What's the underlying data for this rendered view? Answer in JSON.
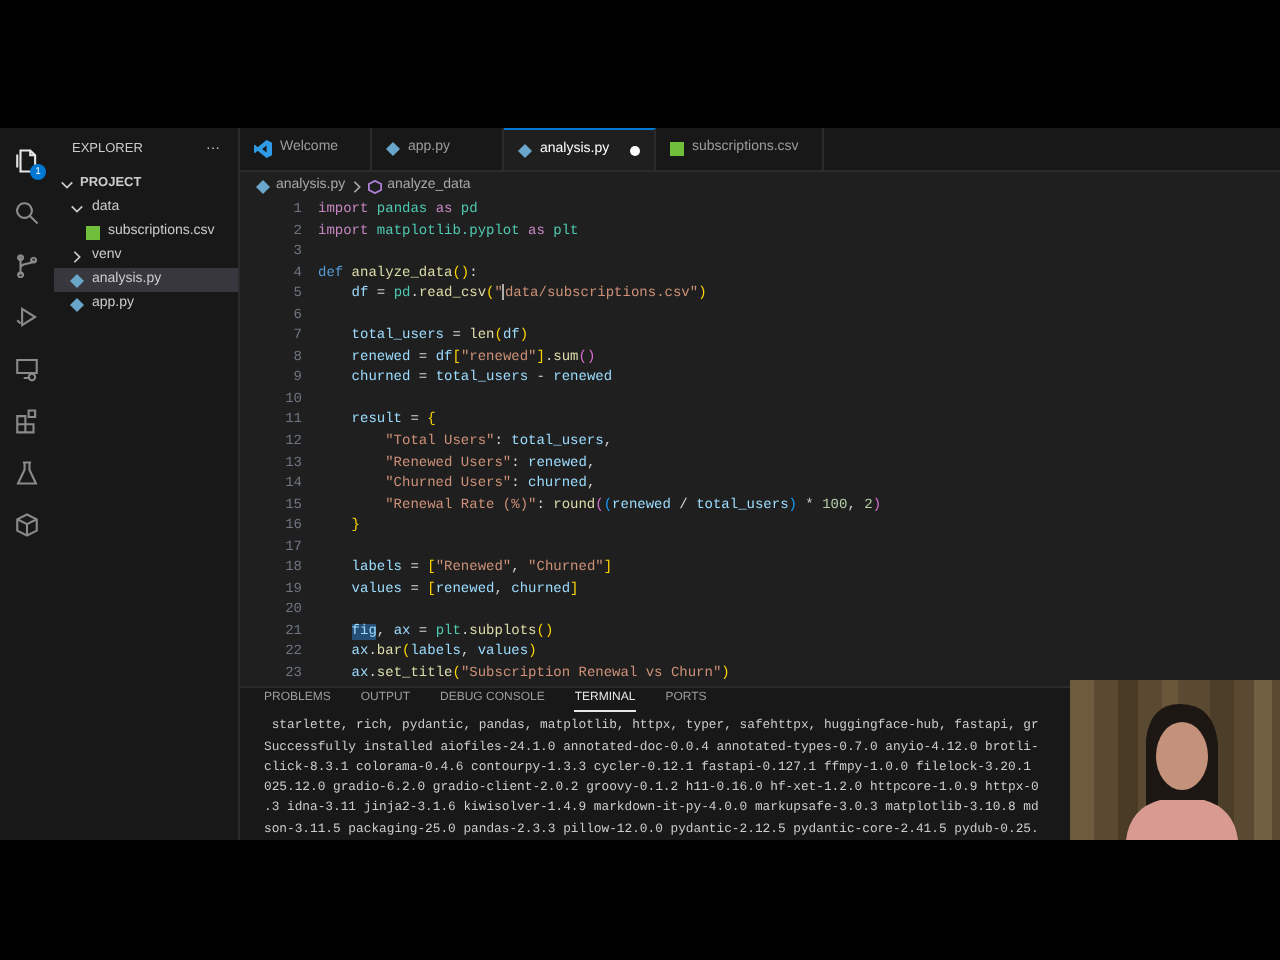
{
  "activity_bar": {
    "badge": "1"
  },
  "explorer": {
    "title": "EXPLORER",
    "more": "···",
    "project": {
      "label": "PROJECT",
      "expanded": true
    },
    "items": [
      {
        "label": "data",
        "kind": "folder",
        "expanded": true,
        "selected": false,
        "children": [
          {
            "label": "subscriptions.csv",
            "kind": "csv",
            "selected": false
          }
        ]
      },
      {
        "label": "venv",
        "kind": "folder",
        "expanded": false,
        "selected": false
      },
      {
        "label": "analysis.py",
        "kind": "py",
        "selected": true
      },
      {
        "label": "app.py",
        "kind": "py",
        "selected": false
      }
    ]
  },
  "tabs": [
    {
      "label": "Welcome",
      "kind": "vscode",
      "selected": false,
      "modified": false
    },
    {
      "label": "app.py",
      "kind": "py",
      "selected": false,
      "modified": false
    },
    {
      "label": "analysis.py",
      "kind": "py",
      "selected": true,
      "modified": true
    },
    {
      "label": "subscriptions.csv",
      "kind": "csv",
      "selected": false,
      "modified": false
    }
  ],
  "breadcrumb": {
    "file": "analysis.py",
    "symbol": "analyze_data"
  },
  "code": [
    {
      "number": "1",
      "tokens": [
        {
          "text": "import",
          "kind": "kw"
        },
        {
          "text": " pandas",
          "kind": "mod"
        },
        {
          "text": " as",
          "kind": "kw"
        },
        {
          "text": " pd",
          "kind": "mod"
        }
      ]
    },
    {
      "number": "2",
      "tokens": [
        {
          "text": "import",
          "kind": "kw"
        },
        {
          "text": " matplotlib.pyplot",
          "kind": "mod"
        },
        {
          "text": " as",
          "kind": "kw"
        },
        {
          "text": " plt",
          "kind": "mod"
        }
      ]
    },
    {
      "number": "3"
    },
    {
      "number": "4",
      "tokens": [
        {
          "text": "def",
          "kind": "def"
        },
        {
          "text": " analyze_data",
          "kind": "fn"
        },
        {
          "text": "()",
          "kind": "br1"
        },
        {
          "text": ":",
          "kind": "op"
        }
      ]
    },
    {
      "number": "5",
      "tokens": [
        {
          "text": "    df",
          "kind": "var"
        },
        {
          "text": " = ",
          "kind": "op"
        },
        {
          "text": "pd",
          "kind": "mod"
        },
        {
          "text": ".",
          "kind": "op"
        },
        {
          "text": "read_csv",
          "kind": "fn"
        },
        {
          "text": "(",
          "kind": "br1"
        },
        {
          "text": "\"",
          "kind": "str"
        },
        {
          "kind": "cursor"
        },
        {
          "text": "data/subscriptions.csv\"",
          "kind": "str"
        },
        {
          "text": ")",
          "kind": "br1"
        }
      ]
    },
    {
      "number": "6"
    },
    {
      "number": "7",
      "tokens": [
        {
          "text": "    total_users",
          "kind": "var"
        },
        {
          "text": " = ",
          "kind": "op"
        },
        {
          "text": "len",
          "kind": "fn"
        },
        {
          "text": "(",
          "kind": "br1"
        },
        {
          "text": "df",
          "kind": "var"
        },
        {
          "text": ")",
          "kind": "br1"
        }
      ]
    },
    {
      "number": "8",
      "tokens": [
        {
          "text": "    renewed",
          "kind": "var"
        },
        {
          "text": " = ",
          "kind": "op"
        },
        {
          "text": "df",
          "kind": "var"
        },
        {
          "text": "[",
          "kind": "br1"
        },
        {
          "text": "\"renewed\"",
          "kind": "str"
        },
        {
          "text": "]",
          "kind": "br1"
        },
        {
          "text": ".",
          "kind": "op"
        },
        {
          "text": "sum",
          "kind": "fn"
        },
        {
          "text": "()",
          "kind": "br2"
        }
      ]
    },
    {
      "number": "9",
      "tokens": [
        {
          "text": "    churned",
          "kind": "var"
        },
        {
          "text": " = ",
          "kind": "op"
        },
        {
          "text": "total_users",
          "kind": "var"
        },
        {
          "text": " - ",
          "kind": "op"
        },
        {
          "text": "renewed",
          "kind": "var"
        }
      ]
    },
    {
      "number": "10"
    },
    {
      "number": "11",
      "tokens": [
        {
          "text": "    result",
          "kind": "var"
        },
        {
          "text": " = ",
          "kind": "op"
        },
        {
          "text": "{",
          "kind": "br1"
        }
      ]
    },
    {
      "number": "12",
      "tokens": [
        {
          "text": "        \"Total Users\"",
          "kind": "str"
        },
        {
          "text": ": ",
          "kind": "op"
        },
        {
          "text": "total_users",
          "kind": "var"
        },
        {
          "text": ",",
          "kind": "op"
        }
      ]
    },
    {
      "number": "13",
      "tokens": [
        {
          "text": "        \"Renewed Users\"",
          "kind": "str"
        },
        {
          "text": ": ",
          "kind": "op"
        },
        {
          "text": "renewed",
          "kind": "var"
        },
        {
          "text": ",",
          "kind": "op"
        }
      ]
    },
    {
      "number": "14",
      "tokens": [
        {
          "text": "        \"Churned Users\"",
          "kind": "str"
        },
        {
          "text": ": ",
          "kind": "op"
        },
        {
          "text": "churned",
          "kind": "var"
        },
        {
          "text": ",",
          "kind": "op"
        }
      ]
    },
    {
      "number": "15",
      "tokens": [
        {
          "text": "        \"Renewal Rate (%)\"",
          "kind": "str"
        },
        {
          "text": ": ",
          "kind": "op"
        },
        {
          "text": "round",
          "kind": "fn"
        },
        {
          "text": "(",
          "kind": "br2"
        },
        {
          "text": "(",
          "kind": "br3"
        },
        {
          "text": "renewed",
          "kind": "var"
        },
        {
          "text": " / ",
          "kind": "op"
        },
        {
          "text": "total_users",
          "kind": "var"
        },
        {
          "text": ")",
          "kind": "br3"
        },
        {
          "text": " * ",
          "kind": "op"
        },
        {
          "text": "100",
          "kind": "num"
        },
        {
          "text": ", ",
          "kind": "op"
        },
        {
          "text": "2",
          "kind": "num"
        },
        {
          "text": ")",
          "kind": "br2"
        }
      ]
    },
    {
      "number": "16",
      "tokens": [
        {
          "text": "    }",
          "kind": "br1"
        }
      ]
    },
    {
      "number": "17"
    },
    {
      "number": "18",
      "tokens": [
        {
          "text": "    labels",
          "kind": "var"
        },
        {
          "text": " = ",
          "kind": "op"
        },
        {
          "text": "[",
          "kind": "br1"
        },
        {
          "text": "\"Renewed\"",
          "kind": "str"
        },
        {
          "text": ", ",
          "kind": "op"
        },
        {
          "text": "\"Churned\"",
          "kind": "str"
        },
        {
          "text": "]",
          "kind": "br1"
        }
      ]
    },
    {
      "number": "19",
      "tokens": [
        {
          "text": "    values",
          "kind": "var"
        },
        {
          "text": " = ",
          "kind": "op"
        },
        {
          "text": "[",
          "kind": "br1"
        },
        {
          "text": "renewed",
          "kind": "var"
        },
        {
          "text": ", ",
          "kind": "op"
        },
        {
          "text": "churned",
          "kind": "var"
        },
        {
          "text": "]",
          "kind": "br1"
        }
      ]
    },
    {
      "number": "20"
    },
    {
      "number": "21",
      "indented": true,
      "tokens": [
        {
          "text": "fig",
          "kind": "hl"
        },
        {
          "text": ", ",
          "kind": "op"
        },
        {
          "text": "ax",
          "kind": "var"
        },
        {
          "text": " = ",
          "kind": "op"
        },
        {
          "text": "plt",
          "kind": "mod"
        },
        {
          "text": ".",
          "kind": "op"
        },
        {
          "text": "subplots",
          "kind": "fn"
        },
        {
          "text": "()",
          "kind": "br1"
        }
      ]
    },
    {
      "number": "22",
      "tokens": [
        {
          "text": "    ax",
          "kind": "var"
        },
        {
          "text": ".",
          "kind": "op"
        },
        {
          "text": "bar",
          "kind": "fn"
        },
        {
          "text": "(",
          "kind": "br1"
        },
        {
          "text": "labels",
          "kind": "var"
        },
        {
          "text": ", ",
          "kind": "op"
        },
        {
          "text": "values",
          "kind": "var"
        },
        {
          "text": ")",
          "kind": "br1"
        }
      ]
    },
    {
      "number": "23",
      "tokens": [
        {
          "text": "    ax",
          "kind": "var"
        },
        {
          "text": ".",
          "kind": "op"
        },
        {
          "text": "set_title",
          "kind": "fn"
        },
        {
          "text": "(",
          "kind": "br1"
        },
        {
          "text": "\"Subscription Renewal vs Churn\"",
          "kind": "str"
        },
        {
          "text": ")",
          "kind": "br1"
        }
      ]
    }
  ],
  "panel_tabs": [
    {
      "label": "PROBLEMS",
      "selected": false
    },
    {
      "label": "OUTPUT",
      "selected": false
    },
    {
      "label": "DEBUG CONSOLE",
      "selected": false
    },
    {
      "label": "TERMINAL",
      "selected": true
    },
    {
      "label": "PORTS",
      "selected": false
    }
  ],
  "terminal": [
    " starlette, rich, pydantic, pandas, matplotlib, httpx, typer, safehttpx, huggingface-hub, fastapi, gr",
    "Successfully installed aiofiles-24.1.0 annotated-doc-0.0.4 annotated-types-0.7.0 anyio-4.12.0 brotli-",
    "click-8.3.1 colorama-0.4.6 contourpy-1.3.3 cycler-0.12.1 fastapi-0.127.1 ffmpy-1.0.0 filelock-3.20.1",
    "025.12.0 gradio-6.2.0 gradio-client-2.0.2 groovy-0.1.2 h11-0.16.0 hf-xet-1.2.0 httpcore-1.0.9 httpx-0",
    ".3 idna-3.11 jinja2-3.1.6 kiwisolver-1.4.9 markdown-it-py-4.0.0 markupsafe-3.0.3 matplotlib-3.10.8 md",
    "son-3.11.5 packaging-25.0 pandas-2.3.3 pillow-12.0.0 pydantic-2.12.5 pydantic-core-2.41.5 pydub-0.25."
  ],
  "webcam": {
    "kind": "picture"
  }
}
